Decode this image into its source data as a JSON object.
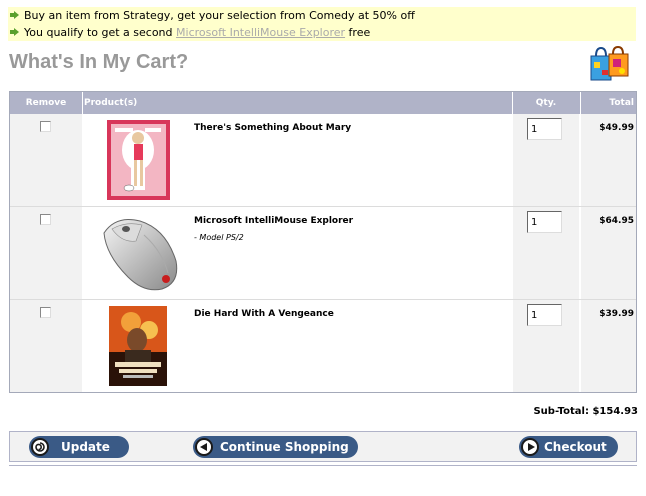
{
  "promo": {
    "line1": "Buy an item from Strategy, get your selection from Comedy at 50% off",
    "line2_prefix": "You qualify to get a second",
    "line2_link": "Microsoft IntelliMouse Explorer",
    "line2_suffix": "free",
    "arrow_icon": "green-arrow-icon"
  },
  "page": {
    "title": "What's In My Cart?",
    "cart_icon": "shopping-bag-icon"
  },
  "table": {
    "headers": {
      "remove": "Remove",
      "product": "Product(s)",
      "qty": "Qty.",
      "total": "Total"
    }
  },
  "items": [
    {
      "name": "There's Something About Mary",
      "model": "",
      "qty": "1",
      "total": "$49.99",
      "thumb": "movie-poster-mary"
    },
    {
      "name": "Microsoft IntelliMouse Explorer",
      "model": "- Model PS/2",
      "qty": "1",
      "total": "$64.95",
      "thumb": "mouse-image"
    },
    {
      "name": "Die Hard With A Vengeance",
      "model": "",
      "qty": "1",
      "total": "$39.99",
      "thumb": "movie-poster-diehard"
    }
  ],
  "summary": {
    "subtotal": "Sub-Total: $154.93"
  },
  "buttons": {
    "update": "Update",
    "continue": "Continue Shopping",
    "checkout": "Checkout"
  },
  "colors": {
    "header_bg": "#b0b3c8",
    "button_bg": "#3a5a86",
    "promo_bg": "#ffffcc",
    "title": "#999999"
  }
}
